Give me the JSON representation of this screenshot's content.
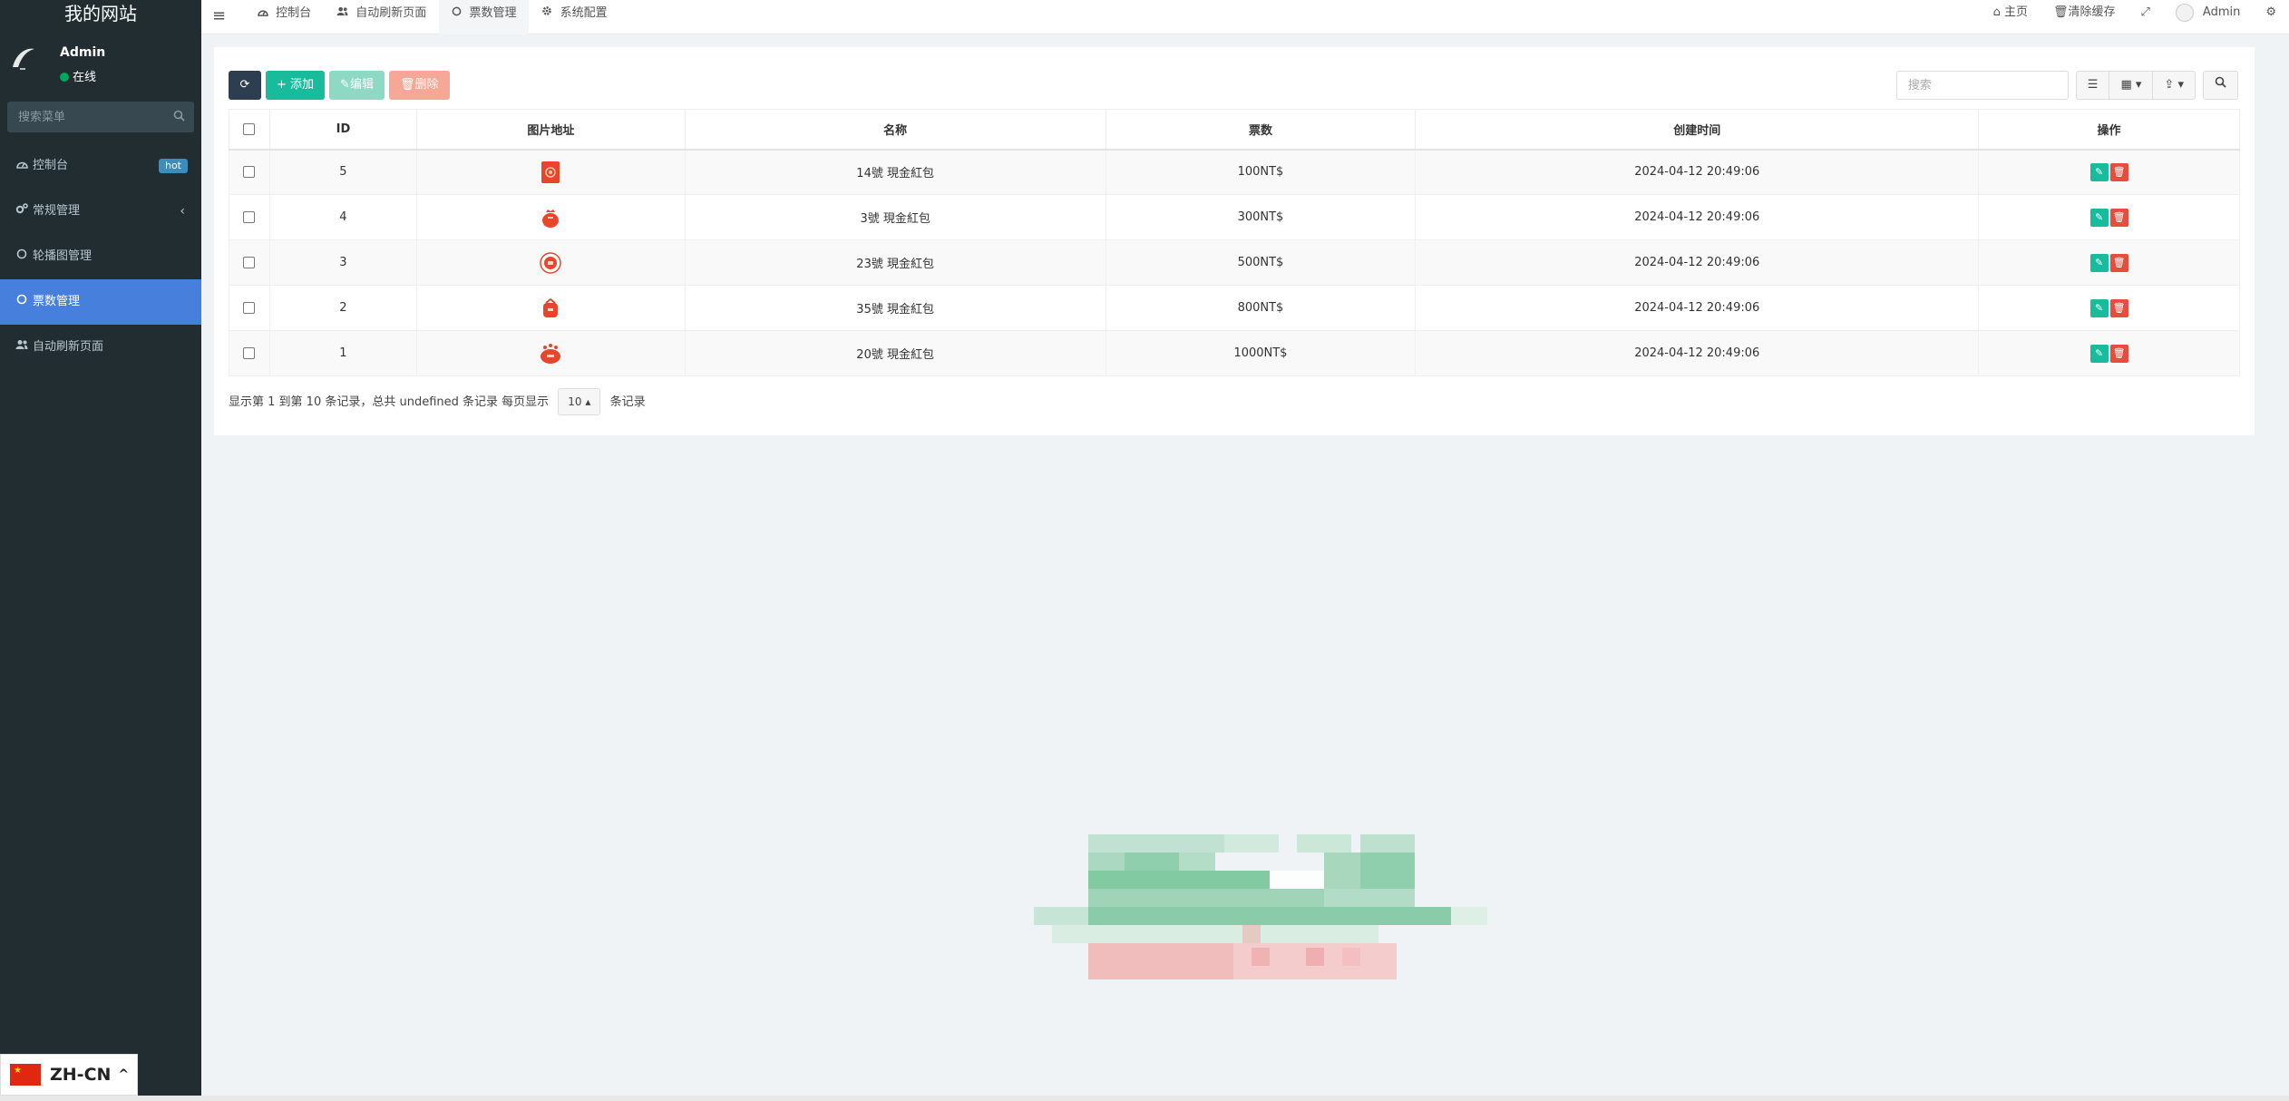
{
  "sidebar": {
    "brand": "我的网站",
    "user_name": "Admin",
    "user_status": "在线",
    "search_placeholder": "搜索菜单",
    "items": [
      {
        "label": "控制台",
        "icon": "dashboard-icon",
        "badge": "hot"
      },
      {
        "label": "常规管理",
        "icon": "cogs-icon"
      },
      {
        "label": "轮播图管理",
        "icon": "circle-icon"
      },
      {
        "label": "票数管理",
        "icon": "circle-icon",
        "active": true
      },
      {
        "label": "自动刷新页面",
        "icon": "users-icon"
      }
    ]
  },
  "topbar": {
    "tabs": [
      {
        "label": "控制台",
        "icon": "dashboard-icon"
      },
      {
        "label": "自动刷新页面",
        "icon": "users-icon"
      },
      {
        "label": "票数管理",
        "icon": "circle-icon",
        "active": true
      },
      {
        "label": "系统配置",
        "icon": "gear-icon"
      }
    ],
    "home_label": "主页",
    "clear_cache_label": "清除缓存",
    "admin_label": "Admin"
  },
  "toolbar": {
    "add_label": "添加",
    "edit_label": "编辑",
    "delete_label": "删除",
    "search_placeholder": "搜索"
  },
  "table": {
    "columns": [
      "ID",
      "图片地址",
      "名称",
      "票数",
      "创建时间",
      "操作"
    ],
    "rows": [
      {
        "id": "5",
        "name": "14號 現金紅包",
        "votes": "100NT$",
        "created": "2024-04-12 20:49:06"
      },
      {
        "id": "4",
        "name": "3號 現金紅包",
        "votes": "300NT$",
        "created": "2024-04-12 20:49:06"
      },
      {
        "id": "3",
        "name": "23號 現金紅包",
        "votes": "500NT$",
        "created": "2024-04-12 20:49:06"
      },
      {
        "id": "2",
        "name": "35號 現金紅包",
        "votes": "800NT$",
        "created": "2024-04-12 20:49:06"
      },
      {
        "id": "1",
        "name": "20號 現金紅包",
        "votes": "1000NT$",
        "created": "2024-04-12 20:49:06"
      }
    ]
  },
  "pagination": {
    "text_before": "显示第 1 到第 10 条记录，总共 undefined 条记录 每页显示",
    "page_size": "10",
    "text_after": "条记录"
  },
  "language": {
    "code": "ZH-CN"
  },
  "colors": {
    "sidebar_bg": "#222d32",
    "active_menu": "#4780dc",
    "add_button": "#18bc9c",
    "delete_icon": "#e74c3c"
  }
}
